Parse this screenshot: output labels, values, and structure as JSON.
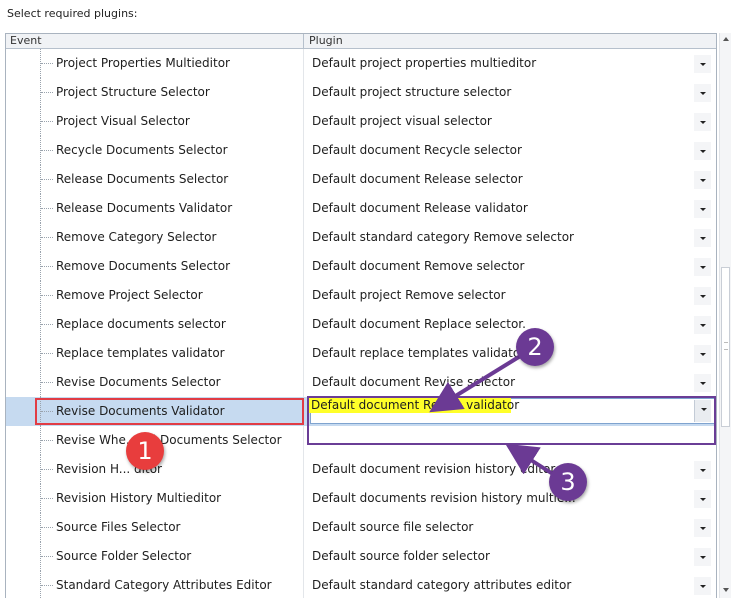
{
  "caption": "Select required plugins:",
  "grid": {
    "columns": {
      "event": "Event",
      "plugin": "Plugin"
    },
    "rows": [
      {
        "event": "Project Properties Multieditor",
        "plugin": "Default project properties multieditor"
      },
      {
        "event": "Project Structure Selector",
        "plugin": "Default project structure selector"
      },
      {
        "event": "Project Visual Selector",
        "plugin": "Default project visual selector"
      },
      {
        "event": "Recycle Documents Selector",
        "plugin": "Default document Recycle selector"
      },
      {
        "event": "Release Documents Selector",
        "plugin": "Default document Release selector"
      },
      {
        "event": "Release Documents Validator",
        "plugin": "Default document Release validator"
      },
      {
        "event": "Remove Category Selector",
        "plugin": "Default standard category Remove selector"
      },
      {
        "event": "Remove Documents Selector",
        "plugin": "Default document Remove selector"
      },
      {
        "event": "Remove Project Selector",
        "plugin": "Default project Remove selector"
      },
      {
        "event": "Replace documents selector",
        "plugin": "Default document Replace selector."
      },
      {
        "event": "Replace templates validator",
        "plugin": "Default replace templates validator"
      },
      {
        "event": "Revise Documents Selector",
        "plugin": "Default document Revise selector"
      },
      {
        "event": "Revise Documents Validator",
        "plugin": "",
        "selected": true
      },
      {
        "event": "Revise Whe... ed Documents Selector",
        "plugin": ""
      },
      {
        "event": "Revision H... ditor",
        "plugin": "Default document revision history editor"
      },
      {
        "event": "Revision History Multieditor",
        "plugin": "Default documents revision history multie..."
      },
      {
        "event": "Source Files Selector",
        "plugin": "Default source file selector"
      },
      {
        "event": "Source Folder Selector",
        "plugin": "Default source folder selector"
      },
      {
        "event": "Standard Category Attributes Editor",
        "plugin": "Default standard category attributes editor"
      }
    ]
  },
  "dropdown": {
    "highlighted_option": "Default document Revise validator"
  },
  "callouts": [
    "1",
    "2",
    "3"
  ],
  "colors": {
    "selection": "#c6daf0",
    "highlight_yellow": "#ffff29",
    "callout_red": "#e83d3d",
    "callout_purple": "#6b3a94"
  }
}
